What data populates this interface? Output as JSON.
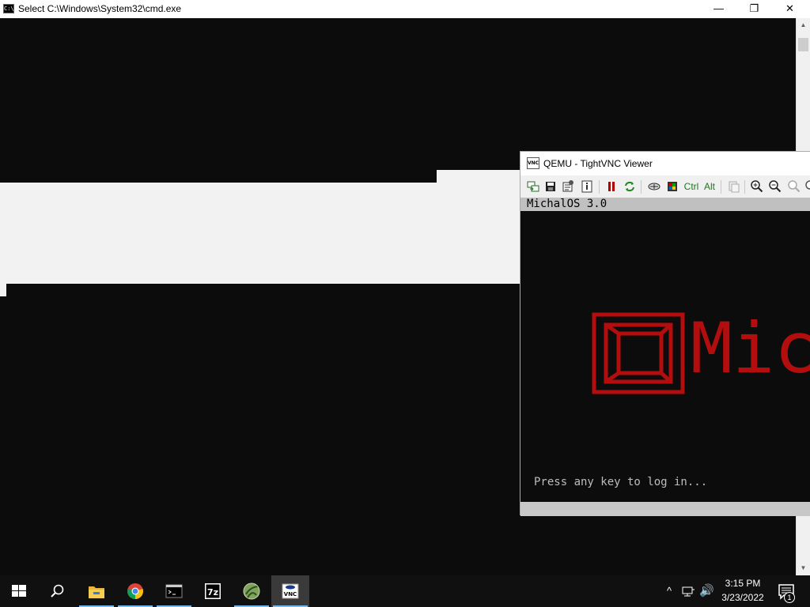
{
  "cmd": {
    "title": "Select C:\\Windows\\System32\\cmd.exe",
    "icon_text": "C:\\",
    "controls": {
      "minimize": "—",
      "maximize": "❐",
      "close": "✕"
    },
    "scroll_up": "▲",
    "scroll_down": "▼"
  },
  "vnc": {
    "title": "QEMU - TightVNC Viewer",
    "icon_text": "VNC",
    "toolbar": {
      "ctrl_label": "Ctrl",
      "alt_label": "Alt"
    },
    "screen": {
      "os_label": "MichalOS 3.0",
      "logo_text": "Mich",
      "prompt": "Press any key to log in..."
    }
  },
  "taskbar": {
    "apps": [
      {
        "name": "start",
        "icon": "windows-logo-icon"
      },
      {
        "name": "search",
        "icon": "search-icon"
      },
      {
        "name": "file-explorer",
        "icon": "folder-icon"
      },
      {
        "name": "chrome",
        "icon": "chrome-icon"
      },
      {
        "name": "command-prompt",
        "icon": "cmd-icon"
      },
      {
        "name": "7zip",
        "icon": "7zip-icon",
        "label": "7z"
      },
      {
        "name": "network-app",
        "icon": "globe-icon"
      },
      {
        "name": "tightvnc",
        "icon": "vnc-icon",
        "label": "VNC"
      }
    ],
    "tray": {
      "chevron": "^",
      "volume": "🔊"
    },
    "clock": {
      "time": "3:15 PM",
      "date": "3/23/2022"
    },
    "notifications": {
      "count": "1"
    }
  },
  "colors": {
    "console_bg": "#0c0c0c",
    "selection": "#f2f2f2",
    "logo_red": "#b30d0d",
    "taskbar_bg": "#101010",
    "active_underline": "#76b9ed"
  }
}
